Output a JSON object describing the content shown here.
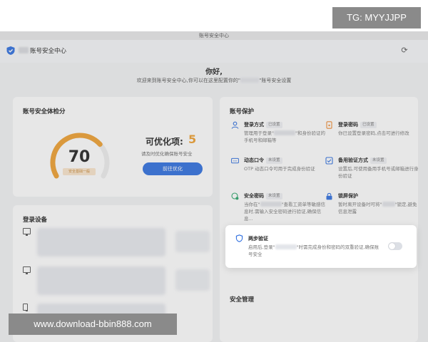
{
  "window": {
    "title": "账号安全中心"
  },
  "app": {
    "title": "账号安全中心",
    "icon": "shield-icon",
    "refresh_icon": "refresh-icon"
  },
  "hero": {
    "title": "你好,",
    "subtitle_a": "欢迎来到账号安全中心,你可以在这里配置你的\"",
    "subtitle_b": "\"账号安全设置"
  },
  "score_card": {
    "title": "账号安全体检分",
    "score": "70",
    "score_fraction": 0.7,
    "score_badge": "安全基础一般",
    "optimizable_label": "可优化项:",
    "optimizable_count": "5",
    "desc": "请及时优化确保账号安全",
    "button": "前往优化",
    "gauge_color": "#f0a030",
    "track_color": "#eeeeee"
  },
  "devices_card": {
    "title": "登录设备"
  },
  "protection": {
    "title": "账号保护",
    "items": [
      {
        "name": "登录方式",
        "badge": "已设置",
        "desc_a": "管理用于登录\"",
        "desc_b": "\"和身份验证的手机号和邮箱等",
        "icon": "user-icon"
      },
      {
        "name": "登录密码",
        "badge": "已设置",
        "desc_a": "你已设置登录密码,点击可进行修改",
        "desc_b": "",
        "icon": "phone-lock-icon"
      },
      {
        "name": "动态口令",
        "badge": "未设置",
        "desc_a": "OTP 动态口令可用于完成身份验证",
        "desc_b": "",
        "icon": "otp-icon"
      },
      {
        "name": "备用验证方式",
        "badge": "未设置",
        "desc_a": "设置后,可使用备用手机号或邮箱进行身份验证",
        "desc_b": "",
        "icon": "backup-check-icon"
      },
      {
        "name": "安全密码",
        "badge": "未设置",
        "desc_a": "当你在\"",
        "desc_b": "\"查看工资单等敏感信息时,需输入安全密码进行验证,确保信息...",
        "icon": "security-password-icon"
      },
      {
        "name": "锁屏保护",
        "badge": "",
        "desc_a": "暂时离开设备时可将\"",
        "desc_b": "\"锁定,避免信息泄露",
        "icon": "lock-screen-icon"
      }
    ],
    "two_step": {
      "name": "两步验证",
      "desc_a": "启用后,登录\"",
      "desc_b": "\"时需完成身份和密码的双重验证,确保账号安全",
      "icon": "shield-check-icon",
      "enabled": false
    }
  },
  "security_management": {
    "title": "安全管理"
  },
  "watermarks": {
    "top": "TG: MYYJJPP",
    "bottom": "www.download-bbin888.com"
  },
  "colors": {
    "accent": "#2f6fe0",
    "warning": "#f0a030",
    "background": "#f2f3f5"
  }
}
